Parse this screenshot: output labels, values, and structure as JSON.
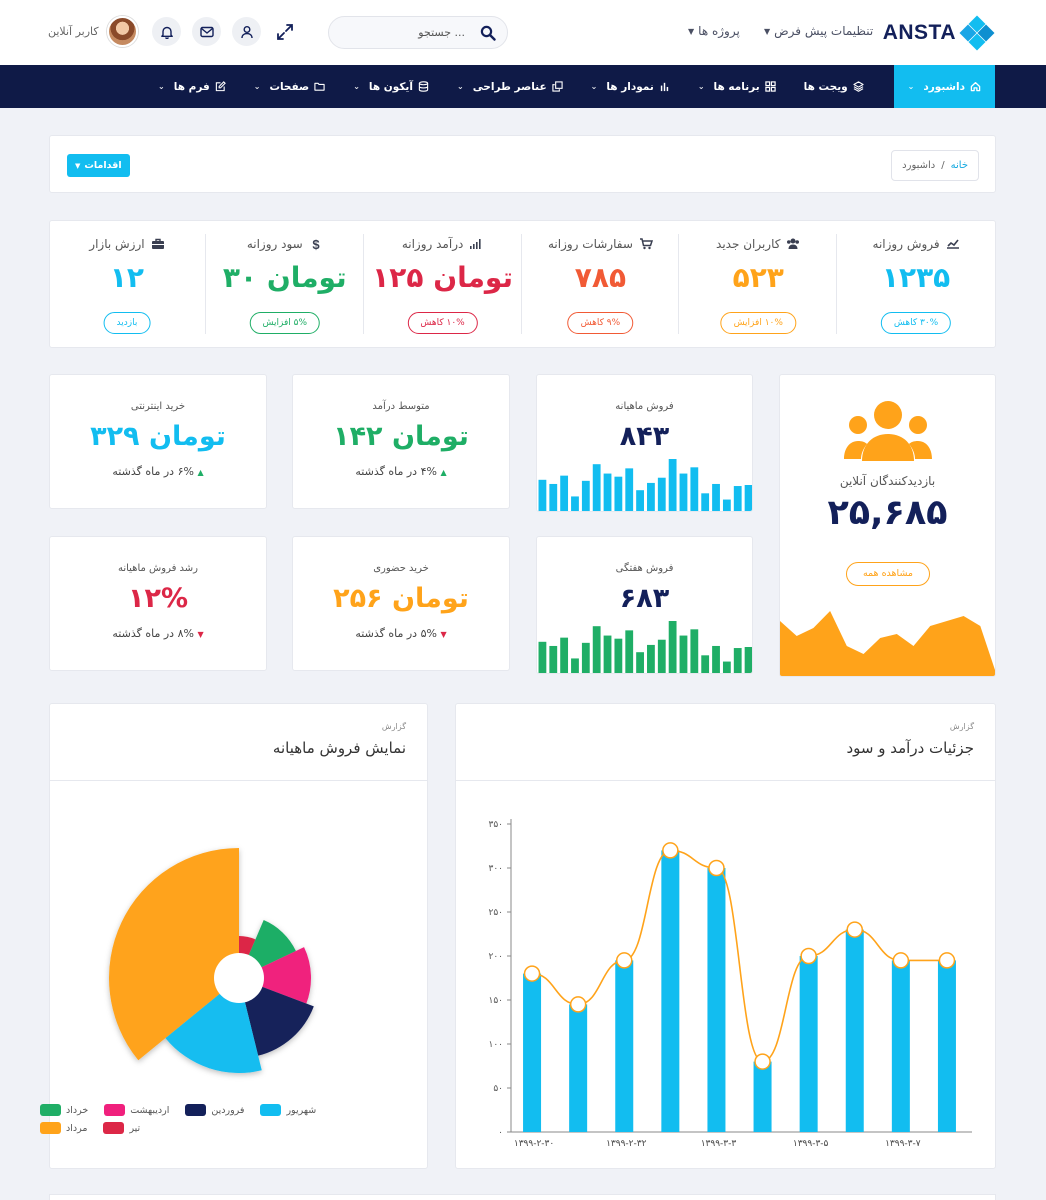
{
  "header": {
    "logo": "ANSTA",
    "menu_default_settings": "تنظیمات پیش فرض",
    "menu_projects": "پروژه ها",
    "search_placeholder": "جستجو ...",
    "user_name": "کاربر آنلاین"
  },
  "nav": {
    "items": [
      {
        "label": "داشبورد",
        "icon": "home-icon"
      },
      {
        "label": "ویجت ها",
        "icon": "layers-icon"
      },
      {
        "label": "برنامه ها",
        "icon": "grid-icon"
      },
      {
        "label": "نمودار ها",
        "icon": "bar-chart-icon"
      },
      {
        "label": "عناصر طراحی",
        "icon": "copy-icon"
      },
      {
        "label": "آیکون ها",
        "icon": "database-icon"
      },
      {
        "label": "صفحات",
        "icon": "folder-icon"
      },
      {
        "label": "فرم ها",
        "icon": "edit-icon"
      }
    ]
  },
  "breadcrumb": {
    "home": "خانه",
    "separator": "/",
    "current": "داشبورد"
  },
  "actions_label": "اقدامات",
  "stats": [
    {
      "label": "فروش روزانه",
      "icon": "line-chart-icon",
      "value": "۱۲۳۵",
      "pill": "۳۰% کاهش",
      "color": "#12bdf0"
    },
    {
      "label": "کاربران جدید",
      "icon": "users-icon",
      "value": "۵۲۳",
      "pill": "۱۰% افزایش",
      "color": "#ffa31a"
    },
    {
      "label": "سفارشات روزانه",
      "icon": "cart-icon",
      "value": "۷۸۵",
      "pill": "۹% کاهش",
      "color": "#f15a35"
    },
    {
      "label": "درآمد روزانه",
      "icon": "signal-icon",
      "value": "۱۲۵ تومان",
      "pill": "۱۰% کاهش",
      "color": "#dc2747"
    },
    {
      "label": "سود روزانه",
      "icon": "dollar-icon",
      "value": "۳۰ تومان",
      "pill": "۵% افزایش",
      "color": "#1fae66"
    },
    {
      "label": "ارزش بازار",
      "icon": "briefcase-icon",
      "value": "۱۲",
      "pill": "بازدید",
      "color": "#12bdf0"
    }
  ],
  "online": {
    "label": "بازدیدکنندگان آنلاین",
    "value": "۲۵,۶۸۵",
    "button": "مشاهده همه",
    "color": "#ffa31a",
    "area_values": [
      55,
      40,
      48,
      65,
      30,
      22,
      38,
      42,
      30,
      50,
      55,
      60,
      50,
      0
    ]
  },
  "monthly_sales": {
    "label": "فروش ماهیانه",
    "value": "۸۴۳",
    "color": "#12bdf0",
    "bars": [
      30,
      26,
      34,
      14,
      29,
      45,
      36,
      33,
      41,
      20,
      27,
      32,
      50,
      36,
      42,
      17,
      26,
      11,
      24,
      25
    ]
  },
  "weekly_sales": {
    "label": "فروش هفتگی",
    "value": "۶۸۳",
    "color": "#1fae66",
    "bars": [
      30,
      26,
      34,
      14,
      29,
      45,
      36,
      33,
      41,
      20,
      27,
      32,
      50,
      36,
      42,
      17,
      26,
      11,
      24,
      25
    ]
  },
  "mini_cards": [
    {
      "label": "متوسط درآمد",
      "value": "۱۴۲ تومان",
      "sub": "۴% در ماه گذشته",
      "trend": "up",
      "color": "#1fae66"
    },
    {
      "label": "خرید اینترنتی",
      "value": "۳۲۹ تومان",
      "sub": "۶% در ماه گذشته",
      "trend": "up",
      "color": "#12bdf0"
    },
    {
      "label": "خرید حضوری",
      "value": "۲۵۶ تومان",
      "sub": "۵% در ماه گذشته",
      "trend": "down",
      "color": "#ffa31a"
    },
    {
      "label": "رشد فروش ماهیانه",
      "value": "۱۲%",
      "sub": "۸% در ماه گذشته",
      "trend": "down",
      "color": "#dc2747"
    }
  ],
  "income_panel": {
    "kicker": "گزارش",
    "title": "جزئیات درآمد و سود"
  },
  "sales_panel": {
    "kicker": "گزارش",
    "title": "نمایش فروش ماهیانه"
  },
  "chart_data": [
    {
      "type": "bar",
      "title": "جزئیات درآمد و سود",
      "categories": [
        "۱۳۹۹-۲-۳۰",
        "",
        "۱۳۹۹-۲-۳۲",
        "",
        "۱۳۹۹-۳-۳",
        "",
        "۱۳۹۹-۳-۵",
        "",
        "۱۳۹۹-۳-۷",
        ""
      ],
      "values": [
        180,
        145,
        195,
        320,
        300,
        80,
        200,
        230,
        195,
        195
      ],
      "line_values": [
        180,
        145,
        195,
        320,
        300,
        80,
        200,
        230,
        195,
        195
      ],
      "yticks": [
        "۰",
        "۵۰",
        "۱۰۰",
        "۱۵۰",
        "۲۰۰",
        "۲۵۰",
        "۳۰۰",
        "۳۵۰"
      ],
      "ylim": [
        0,
        350
      ],
      "bar_color": "#12bdf0",
      "line_color": "#ffa31a"
    },
    {
      "type": "pie",
      "title": "نمایش فروش ماهیانه",
      "series": [
        {
          "name": "تیر",
          "value": 5,
          "radius": 42,
          "color": "#dc2747"
        },
        {
          "name": "خرداد",
          "value": 9,
          "radius": 63,
          "color": "#1fae66"
        },
        {
          "name": "اردیبهشت",
          "value": 10,
          "radius": 72,
          "color": "#f0207d"
        },
        {
          "name": "فروردین",
          "value": 12,
          "radius": 80,
          "color": "#13205a"
        },
        {
          "name": "شهریور",
          "value": 14,
          "radius": 95,
          "color": "#12bdf0"
        },
        {
          "name": "مرداد",
          "value": 28,
          "radius": 130,
          "color": "#ffa31a"
        }
      ],
      "legend_order": [
        "شهریور",
        "فروردین",
        "اردیبهشت",
        "خرداد",
        "تیر",
        "مرداد"
      ]
    }
  ]
}
